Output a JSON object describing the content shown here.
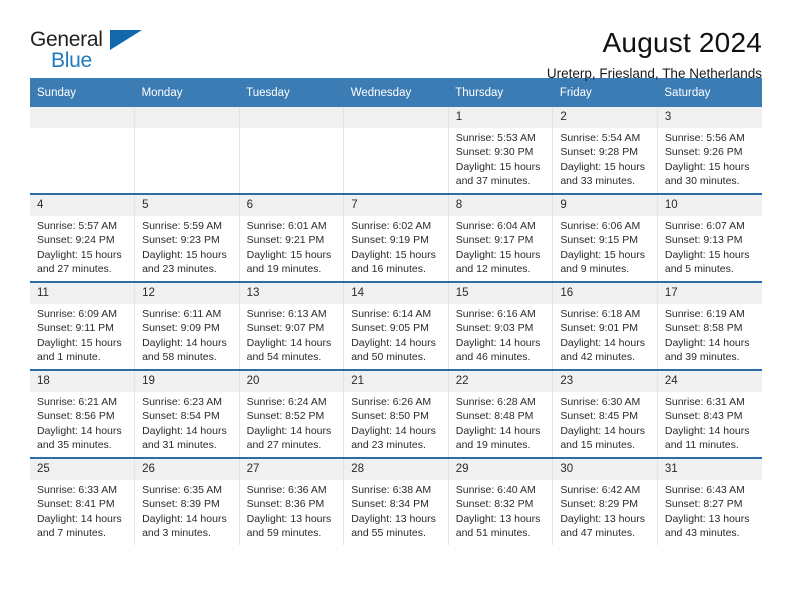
{
  "brand": {
    "name_top": "General",
    "name_bottom": "Blue",
    "accent_color": "#1268ad",
    "text_color": "#231f20"
  },
  "header": {
    "title": "August 2024",
    "subtitle": "Ureterp, Friesland, The Netherlands"
  },
  "theme": {
    "header_band": "#3c7cb5",
    "row_border": "#2e6da4",
    "daynum_band": "#f0f0f0"
  },
  "weekdays": [
    "Sunday",
    "Monday",
    "Tuesday",
    "Wednesday",
    "Thursday",
    "Friday",
    "Saturday"
  ],
  "labels": {
    "sunrise": "Sunrise:",
    "sunset": "Sunset:",
    "daylight": "Daylight:"
  },
  "weeks": [
    [
      {
        "day": "",
        "empty": true
      },
      {
        "day": "",
        "empty": true
      },
      {
        "day": "",
        "empty": true
      },
      {
        "day": "",
        "empty": true
      },
      {
        "day": "1",
        "sunrise": "Sunrise: 5:53 AM",
        "sunset": "Sunset: 9:30 PM",
        "daylight_line1": "Daylight: 15 hours",
        "daylight_line2": "and 37 minutes."
      },
      {
        "day": "2",
        "sunrise": "Sunrise: 5:54 AM",
        "sunset": "Sunset: 9:28 PM",
        "daylight_line1": "Daylight: 15 hours",
        "daylight_line2": "and 33 minutes."
      },
      {
        "day": "3",
        "sunrise": "Sunrise: 5:56 AM",
        "sunset": "Sunset: 9:26 PM",
        "daylight_line1": "Daylight: 15 hours",
        "daylight_line2": "and 30 minutes."
      }
    ],
    [
      {
        "day": "4",
        "sunrise": "Sunrise: 5:57 AM",
        "sunset": "Sunset: 9:24 PM",
        "daylight_line1": "Daylight: 15 hours",
        "daylight_line2": "and 27 minutes."
      },
      {
        "day": "5",
        "sunrise": "Sunrise: 5:59 AM",
        "sunset": "Sunset: 9:23 PM",
        "daylight_line1": "Daylight: 15 hours",
        "daylight_line2": "and 23 minutes."
      },
      {
        "day": "6",
        "sunrise": "Sunrise: 6:01 AM",
        "sunset": "Sunset: 9:21 PM",
        "daylight_line1": "Daylight: 15 hours",
        "daylight_line2": "and 19 minutes."
      },
      {
        "day": "7",
        "sunrise": "Sunrise: 6:02 AM",
        "sunset": "Sunset: 9:19 PM",
        "daylight_line1": "Daylight: 15 hours",
        "daylight_line2": "and 16 minutes."
      },
      {
        "day": "8",
        "sunrise": "Sunrise: 6:04 AM",
        "sunset": "Sunset: 9:17 PM",
        "daylight_line1": "Daylight: 15 hours",
        "daylight_line2": "and 12 minutes."
      },
      {
        "day": "9",
        "sunrise": "Sunrise: 6:06 AM",
        "sunset": "Sunset: 9:15 PM",
        "daylight_line1": "Daylight: 15 hours",
        "daylight_line2": "and 9 minutes."
      },
      {
        "day": "10",
        "sunrise": "Sunrise: 6:07 AM",
        "sunset": "Sunset: 9:13 PM",
        "daylight_line1": "Daylight: 15 hours",
        "daylight_line2": "and 5 minutes."
      }
    ],
    [
      {
        "day": "11",
        "sunrise": "Sunrise: 6:09 AM",
        "sunset": "Sunset: 9:11 PM",
        "daylight_line1": "Daylight: 15 hours",
        "daylight_line2": "and 1 minute."
      },
      {
        "day": "12",
        "sunrise": "Sunrise: 6:11 AM",
        "sunset": "Sunset: 9:09 PM",
        "daylight_line1": "Daylight: 14 hours",
        "daylight_line2": "and 58 minutes."
      },
      {
        "day": "13",
        "sunrise": "Sunrise: 6:13 AM",
        "sunset": "Sunset: 9:07 PM",
        "daylight_line1": "Daylight: 14 hours",
        "daylight_line2": "and 54 minutes."
      },
      {
        "day": "14",
        "sunrise": "Sunrise: 6:14 AM",
        "sunset": "Sunset: 9:05 PM",
        "daylight_line1": "Daylight: 14 hours",
        "daylight_line2": "and 50 minutes."
      },
      {
        "day": "15",
        "sunrise": "Sunrise: 6:16 AM",
        "sunset": "Sunset: 9:03 PM",
        "daylight_line1": "Daylight: 14 hours",
        "daylight_line2": "and 46 minutes."
      },
      {
        "day": "16",
        "sunrise": "Sunrise: 6:18 AM",
        "sunset": "Sunset: 9:01 PM",
        "daylight_line1": "Daylight: 14 hours",
        "daylight_line2": "and 42 minutes."
      },
      {
        "day": "17",
        "sunrise": "Sunrise: 6:19 AM",
        "sunset": "Sunset: 8:58 PM",
        "daylight_line1": "Daylight: 14 hours",
        "daylight_line2": "and 39 minutes."
      }
    ],
    [
      {
        "day": "18",
        "sunrise": "Sunrise: 6:21 AM",
        "sunset": "Sunset: 8:56 PM",
        "daylight_line1": "Daylight: 14 hours",
        "daylight_line2": "and 35 minutes."
      },
      {
        "day": "19",
        "sunrise": "Sunrise: 6:23 AM",
        "sunset": "Sunset: 8:54 PM",
        "daylight_line1": "Daylight: 14 hours",
        "daylight_line2": "and 31 minutes."
      },
      {
        "day": "20",
        "sunrise": "Sunrise: 6:24 AM",
        "sunset": "Sunset: 8:52 PM",
        "daylight_line1": "Daylight: 14 hours",
        "daylight_line2": "and 27 minutes."
      },
      {
        "day": "21",
        "sunrise": "Sunrise: 6:26 AM",
        "sunset": "Sunset: 8:50 PM",
        "daylight_line1": "Daylight: 14 hours",
        "daylight_line2": "and 23 minutes."
      },
      {
        "day": "22",
        "sunrise": "Sunrise: 6:28 AM",
        "sunset": "Sunset: 8:48 PM",
        "daylight_line1": "Daylight: 14 hours",
        "daylight_line2": "and 19 minutes."
      },
      {
        "day": "23",
        "sunrise": "Sunrise: 6:30 AM",
        "sunset": "Sunset: 8:45 PM",
        "daylight_line1": "Daylight: 14 hours",
        "daylight_line2": "and 15 minutes."
      },
      {
        "day": "24",
        "sunrise": "Sunrise: 6:31 AM",
        "sunset": "Sunset: 8:43 PM",
        "daylight_line1": "Daylight: 14 hours",
        "daylight_line2": "and 11 minutes."
      }
    ],
    [
      {
        "day": "25",
        "sunrise": "Sunrise: 6:33 AM",
        "sunset": "Sunset: 8:41 PM",
        "daylight_line1": "Daylight: 14 hours",
        "daylight_line2": "and 7 minutes."
      },
      {
        "day": "26",
        "sunrise": "Sunrise: 6:35 AM",
        "sunset": "Sunset: 8:39 PM",
        "daylight_line1": "Daylight: 14 hours",
        "daylight_line2": "and 3 minutes."
      },
      {
        "day": "27",
        "sunrise": "Sunrise: 6:36 AM",
        "sunset": "Sunset: 8:36 PM",
        "daylight_line1": "Daylight: 13 hours",
        "daylight_line2": "and 59 minutes."
      },
      {
        "day": "28",
        "sunrise": "Sunrise: 6:38 AM",
        "sunset": "Sunset: 8:34 PM",
        "daylight_line1": "Daylight: 13 hours",
        "daylight_line2": "and 55 minutes."
      },
      {
        "day": "29",
        "sunrise": "Sunrise: 6:40 AM",
        "sunset": "Sunset: 8:32 PM",
        "daylight_line1": "Daylight: 13 hours",
        "daylight_line2": "and 51 minutes."
      },
      {
        "day": "30",
        "sunrise": "Sunrise: 6:42 AM",
        "sunset": "Sunset: 8:29 PM",
        "daylight_line1": "Daylight: 13 hours",
        "daylight_line2": "and 47 minutes."
      },
      {
        "day": "31",
        "sunrise": "Sunrise: 6:43 AM",
        "sunset": "Sunset: 8:27 PM",
        "daylight_line1": "Daylight: 13 hours",
        "daylight_line2": "and 43 minutes."
      }
    ]
  ]
}
